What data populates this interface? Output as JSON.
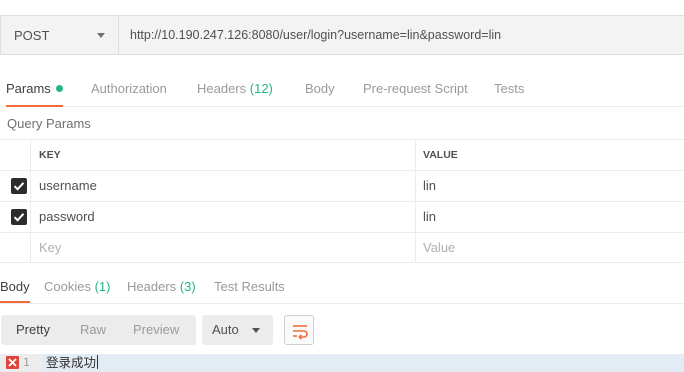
{
  "request": {
    "method": "POST",
    "url": "http://10.190.247.126:8080/user/login?username=lin&password=lin"
  },
  "request_tabs": [
    {
      "label": "Params",
      "active": true,
      "dot_color": "#26b47f"
    },
    {
      "label": "Authorization"
    },
    {
      "label": "Headers",
      "count": "(12)"
    },
    {
      "label": "Body"
    },
    {
      "label": "Pre-request Script"
    },
    {
      "label": "Tests"
    }
  ],
  "query_params": {
    "title": "Query Params",
    "columns": [
      "KEY",
      "VALUE"
    ],
    "rows": [
      {
        "key": "username",
        "value": "lin",
        "checked": true
      },
      {
        "key": "password",
        "value": "lin",
        "checked": true
      }
    ],
    "placeholder": {
      "key": "Key",
      "value": "Value"
    }
  },
  "response_tabs": [
    {
      "label": "Body",
      "active": true
    },
    {
      "label": "Cookies",
      "count": "(1)"
    },
    {
      "label": "Headers",
      "count": "(3)"
    },
    {
      "label": "Test Results"
    }
  ],
  "response_toolbar": {
    "views": [
      "Pretty",
      "Raw",
      "Preview"
    ],
    "active_view": "Pretty",
    "format": "Auto",
    "wrap_icon": "wrap-lines-icon"
  },
  "editor": {
    "line_number": "1",
    "line_text": "登录成功",
    "error_icon": "error-marker-icon"
  },
  "colors": {
    "accent": "#f26b3a",
    "green": "#26b47f",
    "error": "#e0443e"
  }
}
